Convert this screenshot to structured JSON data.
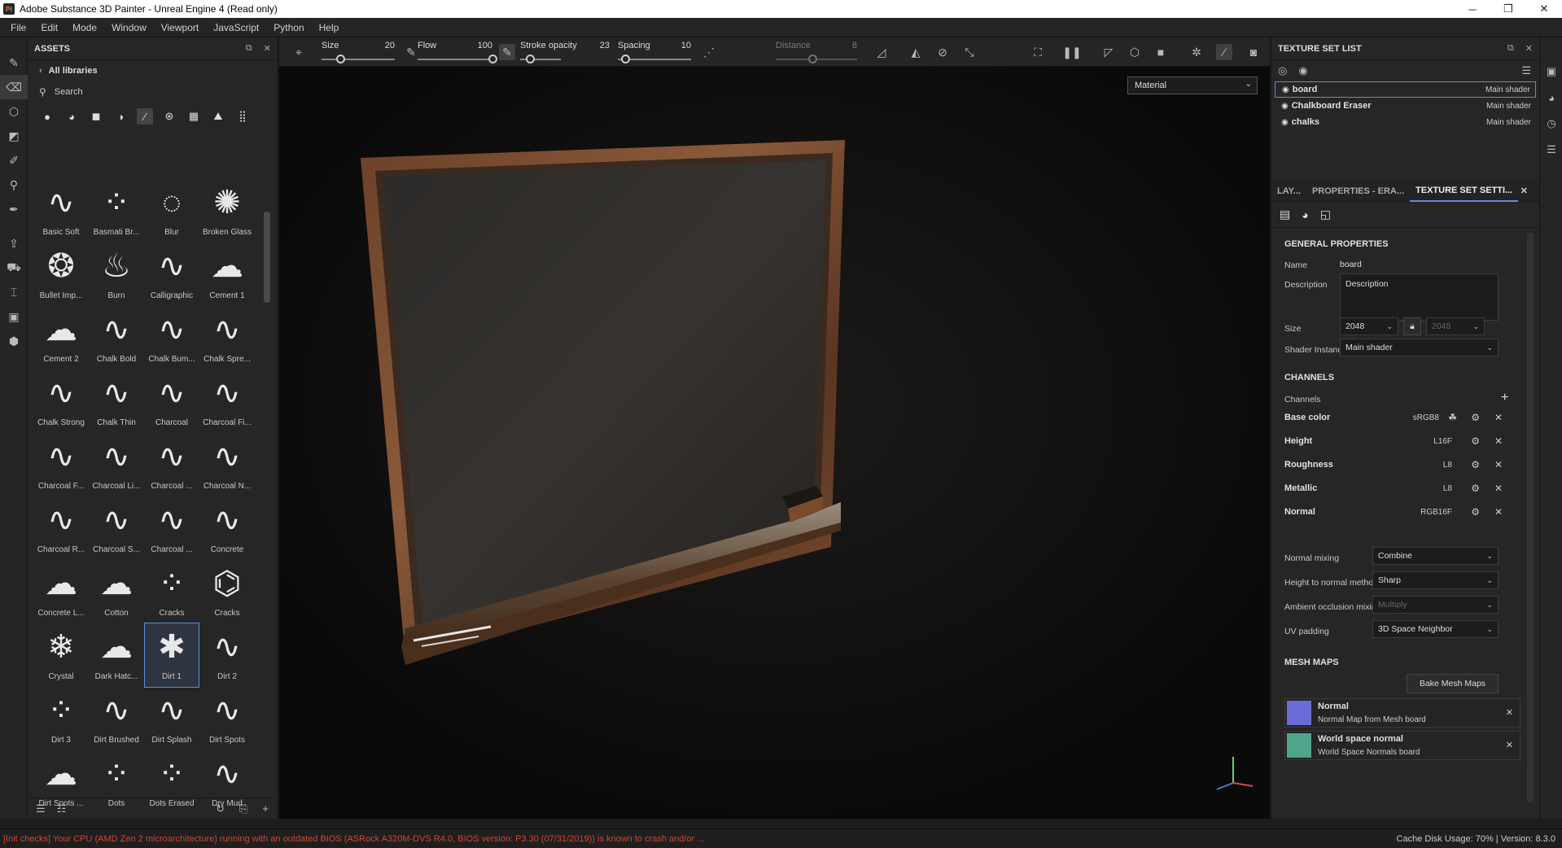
{
  "window": {
    "title": "Adobe Substance 3D Painter - Unreal Engine 4 (Read only)",
    "app_badge": "Pt",
    "min": "─",
    "max": "❐",
    "close": "✕"
  },
  "menu": [
    "File",
    "Edit",
    "Mode",
    "Window",
    "Viewport",
    "JavaScript",
    "Python",
    "Help"
  ],
  "assets": {
    "title": "ASSETS",
    "library": "All libraries",
    "search_placeholder": "Search",
    "items": [
      "Basic Soft",
      "Basmati Br...",
      "Blur",
      "Broken Glass",
      "Bullet Imp...",
      "Burn",
      "Calligraphic",
      "Cement 1",
      "Cement 2",
      "Chalk Bold",
      "Chalk Bum...",
      "Chalk Spre...",
      "Chalk Strong",
      "Chalk Thin",
      "Charcoal",
      "Charcoal Fi...",
      "Charcoal F...",
      "Charcoal Li...",
      "Charcoal ...",
      "Charcoal N...",
      "Charcoal R...",
      "Charcoal S...",
      "Charcoal ...",
      "Concrete",
      "Concrete L...",
      "Cotton",
      "Cracks",
      "Cracks",
      "Crystal",
      "Dark Hatc...",
      "Dirt 1",
      "Dirt 2",
      "Dirt 3",
      "Dirt Brushed",
      "Dirt Splash",
      "Dirt Spots",
      "Dirt Spots ...",
      "Dots",
      "Dots Erased",
      "Dry Mud"
    ],
    "selected_item": "Dirt 1"
  },
  "toolbar": {
    "size": {
      "label": "Size",
      "value": "20",
      "fraction": 0.25
    },
    "flow": {
      "label": "Flow",
      "value": "100",
      "fraction": 1.0
    },
    "stroke_opacity": {
      "label": "Stroke opacity",
      "value": "23",
      "fraction": 0.23
    },
    "spacing": {
      "label": "Spacing",
      "value": "10",
      "fraction": 0.1
    },
    "distance": {
      "label": "Distance",
      "value": "8",
      "fraction": 0.45
    }
  },
  "viewport": {
    "material_mode": "Material"
  },
  "texture_set_list": {
    "title": "TEXTURE SET LIST",
    "sets": [
      {
        "name": "board",
        "shader": "Main shader"
      },
      {
        "name": "Chalkboard Eraser",
        "shader": "Main shader"
      },
      {
        "name": "chalks",
        "shader": "Main shader"
      }
    ]
  },
  "tabs": [
    "LAY...",
    "PROPERTIES - ERA...",
    "TEXTURE SET SETTI..."
  ],
  "settings": {
    "general_title": "GENERAL PROPERTIES",
    "name_label": "Name",
    "name_value": "board",
    "desc_label": "Description",
    "desc_placeholder": "Description",
    "size_label": "Size",
    "size_value": "2048",
    "size_value2": "2048",
    "shader_label": "Shader Instance",
    "shader_value": "Main shader",
    "channels_title": "CHANNELS",
    "channels_label": "Channels",
    "channels": [
      {
        "name": "Base color",
        "format": "sRGB8"
      },
      {
        "name": "Height",
        "format": "L16F"
      },
      {
        "name": "Roughness",
        "format": "L8"
      },
      {
        "name": "Metallic",
        "format": "L8"
      },
      {
        "name": "Normal",
        "format": "RGB16F"
      }
    ],
    "normal_mixing_label": "Normal mixing",
    "normal_mixing": "Combine",
    "h2n_label": "Height to normal method",
    "h2n": "Sharp",
    "ao_label": "Ambient occlusion mixing",
    "ao": "Multiply",
    "uv_label": "UV padding",
    "uv": "3D Space Neighbor",
    "mesh_maps_title": "MESH MAPS",
    "bake_button": "Bake Mesh Maps",
    "mesh_maps": [
      {
        "name": "Normal",
        "desc": "Normal Map from Mesh board",
        "color": "#6b6bd6"
      },
      {
        "name": "World space normal",
        "desc": "World Space Normals board",
        "color": "#4fa58c"
      }
    ]
  },
  "status": {
    "error": "[Init checks] Your CPU (AMD Zen 2 microarchitecture) running with an outdated BIOS (ASRock A320M-DVS R4.0, BIOS version: P3.30 (07/31/2019)) is known to crash and/or ...",
    "cache": "Cache Disk Usage:   70% | Version: 8.3.0"
  }
}
